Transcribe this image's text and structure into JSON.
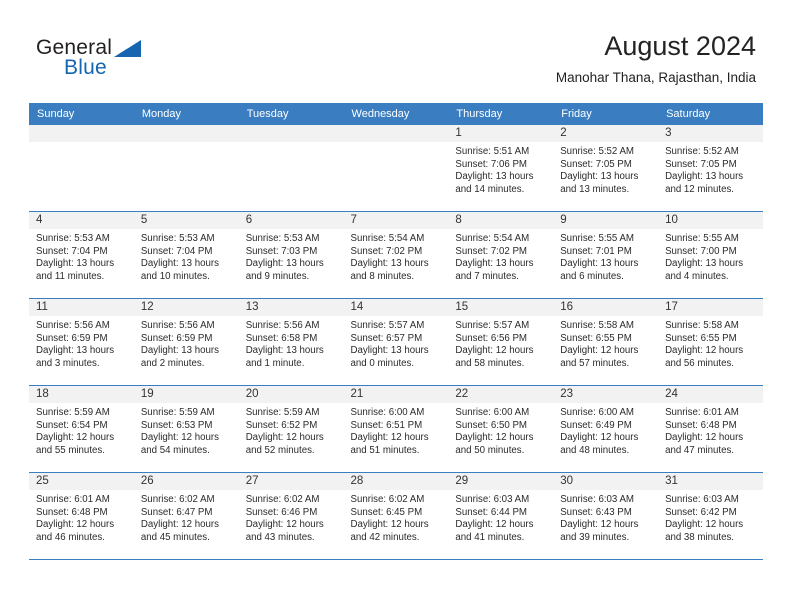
{
  "brand": {
    "name_top": "General",
    "name_bottom": "Blue",
    "accent_color": "#1565b0"
  },
  "header": {
    "title": "August 2024",
    "subtitle": "Manohar Thana, Rajasthan, India"
  },
  "theme": {
    "header_row_bg": "#3a7ec1",
    "daynum_band_bg": "#f2f2f2",
    "grid_line": "#3a7ec1"
  },
  "weekdays": [
    "Sunday",
    "Monday",
    "Tuesday",
    "Wednesday",
    "Thursday",
    "Friday",
    "Saturday"
  ],
  "weeks": [
    [
      {
        "day": "",
        "lines": []
      },
      {
        "day": "",
        "lines": []
      },
      {
        "day": "",
        "lines": []
      },
      {
        "day": "",
        "lines": []
      },
      {
        "day": "1",
        "lines": [
          "Sunrise: 5:51 AM",
          "Sunset: 7:06 PM",
          "Daylight: 13 hours",
          "and 14 minutes."
        ]
      },
      {
        "day": "2",
        "lines": [
          "Sunrise: 5:52 AM",
          "Sunset: 7:05 PM",
          "Daylight: 13 hours",
          "and 13 minutes."
        ]
      },
      {
        "day": "3",
        "lines": [
          "Sunrise: 5:52 AM",
          "Sunset: 7:05 PM",
          "Daylight: 13 hours",
          "and 12 minutes."
        ]
      }
    ],
    [
      {
        "day": "4",
        "lines": [
          "Sunrise: 5:53 AM",
          "Sunset: 7:04 PM",
          "Daylight: 13 hours",
          "and 11 minutes."
        ]
      },
      {
        "day": "5",
        "lines": [
          "Sunrise: 5:53 AM",
          "Sunset: 7:04 PM",
          "Daylight: 13 hours",
          "and 10 minutes."
        ]
      },
      {
        "day": "6",
        "lines": [
          "Sunrise: 5:53 AM",
          "Sunset: 7:03 PM",
          "Daylight: 13 hours",
          "and 9 minutes."
        ]
      },
      {
        "day": "7",
        "lines": [
          "Sunrise: 5:54 AM",
          "Sunset: 7:02 PM",
          "Daylight: 13 hours",
          "and 8 minutes."
        ]
      },
      {
        "day": "8",
        "lines": [
          "Sunrise: 5:54 AM",
          "Sunset: 7:02 PM",
          "Daylight: 13 hours",
          "and 7 minutes."
        ]
      },
      {
        "day": "9",
        "lines": [
          "Sunrise: 5:55 AM",
          "Sunset: 7:01 PM",
          "Daylight: 13 hours",
          "and 6 minutes."
        ]
      },
      {
        "day": "10",
        "lines": [
          "Sunrise: 5:55 AM",
          "Sunset: 7:00 PM",
          "Daylight: 13 hours",
          "and 4 minutes."
        ]
      }
    ],
    [
      {
        "day": "11",
        "lines": [
          "Sunrise: 5:56 AM",
          "Sunset: 6:59 PM",
          "Daylight: 13 hours",
          "and 3 minutes."
        ]
      },
      {
        "day": "12",
        "lines": [
          "Sunrise: 5:56 AM",
          "Sunset: 6:59 PM",
          "Daylight: 13 hours",
          "and 2 minutes."
        ]
      },
      {
        "day": "13",
        "lines": [
          "Sunrise: 5:56 AM",
          "Sunset: 6:58 PM",
          "Daylight: 13 hours",
          "and 1 minute."
        ]
      },
      {
        "day": "14",
        "lines": [
          "Sunrise: 5:57 AM",
          "Sunset: 6:57 PM",
          "Daylight: 13 hours",
          "and 0 minutes."
        ]
      },
      {
        "day": "15",
        "lines": [
          "Sunrise: 5:57 AM",
          "Sunset: 6:56 PM",
          "Daylight: 12 hours",
          "and 58 minutes."
        ]
      },
      {
        "day": "16",
        "lines": [
          "Sunrise: 5:58 AM",
          "Sunset: 6:55 PM",
          "Daylight: 12 hours",
          "and 57 minutes."
        ]
      },
      {
        "day": "17",
        "lines": [
          "Sunrise: 5:58 AM",
          "Sunset: 6:55 PM",
          "Daylight: 12 hours",
          "and 56 minutes."
        ]
      }
    ],
    [
      {
        "day": "18",
        "lines": [
          "Sunrise: 5:59 AM",
          "Sunset: 6:54 PM",
          "Daylight: 12 hours",
          "and 55 minutes."
        ]
      },
      {
        "day": "19",
        "lines": [
          "Sunrise: 5:59 AM",
          "Sunset: 6:53 PM",
          "Daylight: 12 hours",
          "and 54 minutes."
        ]
      },
      {
        "day": "20",
        "lines": [
          "Sunrise: 5:59 AM",
          "Sunset: 6:52 PM",
          "Daylight: 12 hours",
          "and 52 minutes."
        ]
      },
      {
        "day": "21",
        "lines": [
          "Sunrise: 6:00 AM",
          "Sunset: 6:51 PM",
          "Daylight: 12 hours",
          "and 51 minutes."
        ]
      },
      {
        "day": "22",
        "lines": [
          "Sunrise: 6:00 AM",
          "Sunset: 6:50 PM",
          "Daylight: 12 hours",
          "and 50 minutes."
        ]
      },
      {
        "day": "23",
        "lines": [
          "Sunrise: 6:00 AM",
          "Sunset: 6:49 PM",
          "Daylight: 12 hours",
          "and 48 minutes."
        ]
      },
      {
        "day": "24",
        "lines": [
          "Sunrise: 6:01 AM",
          "Sunset: 6:48 PM",
          "Daylight: 12 hours",
          "and 47 minutes."
        ]
      }
    ],
    [
      {
        "day": "25",
        "lines": [
          "Sunrise: 6:01 AM",
          "Sunset: 6:48 PM",
          "Daylight: 12 hours",
          "and 46 minutes."
        ]
      },
      {
        "day": "26",
        "lines": [
          "Sunrise: 6:02 AM",
          "Sunset: 6:47 PM",
          "Daylight: 12 hours",
          "and 45 minutes."
        ]
      },
      {
        "day": "27",
        "lines": [
          "Sunrise: 6:02 AM",
          "Sunset: 6:46 PM",
          "Daylight: 12 hours",
          "and 43 minutes."
        ]
      },
      {
        "day": "28",
        "lines": [
          "Sunrise: 6:02 AM",
          "Sunset: 6:45 PM",
          "Daylight: 12 hours",
          "and 42 minutes."
        ]
      },
      {
        "day": "29",
        "lines": [
          "Sunrise: 6:03 AM",
          "Sunset: 6:44 PM",
          "Daylight: 12 hours",
          "and 41 minutes."
        ]
      },
      {
        "day": "30",
        "lines": [
          "Sunrise: 6:03 AM",
          "Sunset: 6:43 PM",
          "Daylight: 12 hours",
          "and 39 minutes."
        ]
      },
      {
        "day": "31",
        "lines": [
          "Sunrise: 6:03 AM",
          "Sunset: 6:42 PM",
          "Daylight: 12 hours",
          "and 38 minutes."
        ]
      }
    ]
  ]
}
